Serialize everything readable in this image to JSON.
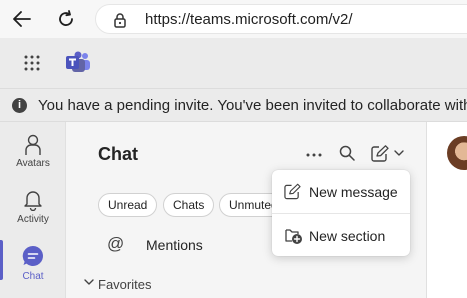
{
  "browser": {
    "url": "https://teams.microsoft.com/v2/"
  },
  "banner": {
    "text": "You have a pending invite. You've been invited to collaborate with Fac"
  },
  "rail": {
    "items": [
      {
        "label": "Avatars",
        "icon": "avatar-person-icon"
      },
      {
        "label": "Activity",
        "icon": "bell-icon"
      },
      {
        "label": "Chat",
        "icon": "chat-icon",
        "active": true
      }
    ],
    "accent": "#5b5fc7"
  },
  "chat": {
    "title": "Chat",
    "filters": [
      "Unread",
      "Chats",
      "Unmuted"
    ],
    "mentions_label": "Mentions",
    "favorites_label": "Favorites"
  },
  "menu": {
    "items": [
      {
        "label": "New message",
        "icon": "compose-icon"
      },
      {
        "label": "New section",
        "icon": "new-section-icon"
      }
    ]
  }
}
